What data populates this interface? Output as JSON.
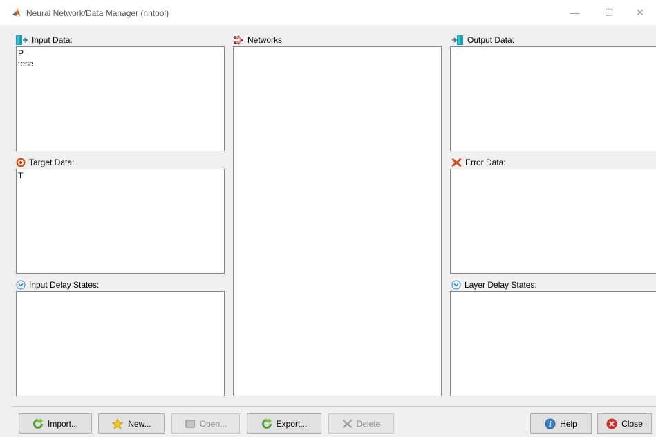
{
  "window": {
    "title": "Neural Network/Data Manager (nntool)",
    "controls": {
      "minimize": "—",
      "maximize": "☐",
      "close": "✕"
    }
  },
  "panels": {
    "input_data": {
      "label": "Input Data:",
      "items": [
        "P",
        "tese"
      ]
    },
    "target_data": {
      "label": "Target Data:",
      "items": [
        "T"
      ]
    },
    "input_delay_states": {
      "label": "Input Delay States:",
      "items": []
    },
    "networks": {
      "label": "Networks",
      "items": []
    },
    "output_data": {
      "label": "Output Data:",
      "items": []
    },
    "error_data": {
      "label": "Error Data:",
      "items": []
    },
    "layer_delay_states": {
      "label": "Layer Delay States:",
      "items": []
    }
  },
  "buttons": {
    "import": "Import...",
    "new": "New...",
    "open": "Open...",
    "export": "Export...",
    "delete": "Delete",
    "help": "Help",
    "close": "Close"
  },
  "colors": {
    "background": "#f0f0f0",
    "list_border": "#828790",
    "button_face": "#e1e1e1"
  }
}
